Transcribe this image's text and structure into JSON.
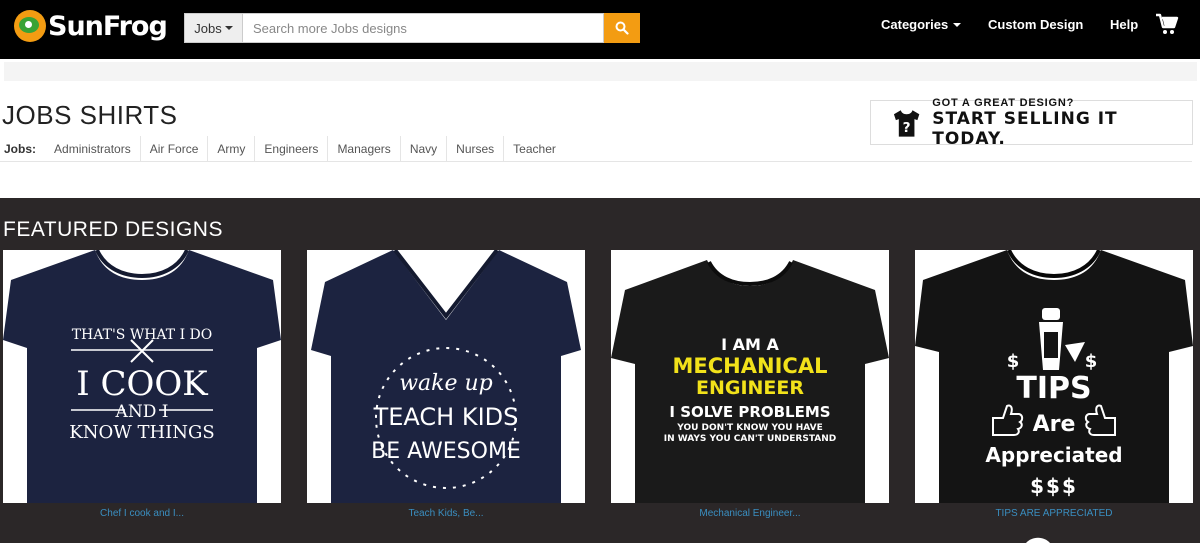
{
  "header": {
    "brand": "SunFrog",
    "search_category": "Jobs",
    "search_placeholder": "Search more Jobs designs",
    "nav": {
      "categories": "Categories",
      "custom_design": "Custom Design",
      "help": "Help"
    }
  },
  "page": {
    "title": "JOBS SHIRTS",
    "subcategory_label": "Jobs:",
    "subcategories": [
      "Administrators",
      "Air Force",
      "Army",
      "Engineers",
      "Managers",
      "Navy",
      "Nurses",
      "Teacher"
    ]
  },
  "promo": {
    "small": "GOT A GREAT DESIGN?",
    "big": "START SELLING IT TODAY."
  },
  "featured": {
    "title": "FEATURED DESIGNS",
    "cards": [
      {
        "label": "Chef I cook and I...",
        "shirt_color": "#1c2340",
        "print_lines": [
          "THAT'S WHAT I DO",
          "I COOK",
          "AND I",
          "KNOW THINGS"
        ]
      },
      {
        "label": "Teach Kids, Be...",
        "shirt_color": "#1c2340",
        "print_lines": [
          "wake up",
          "TEACH KIDS",
          "BE AWESOME"
        ]
      },
      {
        "label": "Mechanical Engineer...",
        "shirt_color": "#1a1a1a",
        "print_lines": [
          "I AM A",
          "MECHANICAL",
          "ENGINEER",
          "I SOLVE PROBLEMS",
          "YOU DON'T KNOW YOU HAVE",
          "IN WAYS YOU CAN'T UNDERSTAND"
        ]
      },
      {
        "label": "TIPS ARE APPRECIATED",
        "shirt_color": "#141414",
        "print_lines": [
          "$",
          "$",
          "TIPS",
          "Are",
          "Appreciated",
          "$$$"
        ]
      }
    ]
  },
  "colors": {
    "accent": "#f39c12",
    "dark_section": "#2b2728",
    "link": "#3a8ec0",
    "engineer_yellow": "#f2e21a"
  }
}
